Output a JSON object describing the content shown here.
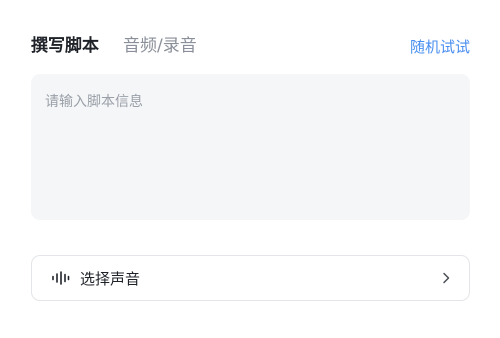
{
  "tabs": [
    {
      "label": "撰写脚本",
      "active": true
    },
    {
      "label": "音频/录音",
      "active": false
    }
  ],
  "random_try_label": "随机试试",
  "script_input": {
    "placeholder": "请输入脚本信息",
    "value": ""
  },
  "voice_select": {
    "label": "选择声音",
    "icon": "waveform-icon",
    "chevron": "chevron-right-icon"
  },
  "colors": {
    "accent": "#4a8ff0",
    "input_bg": "#f5f6f8",
    "border": "#e3e5e8",
    "text_primary": "#1f2329",
    "text_secondary": "#8a8f99"
  }
}
